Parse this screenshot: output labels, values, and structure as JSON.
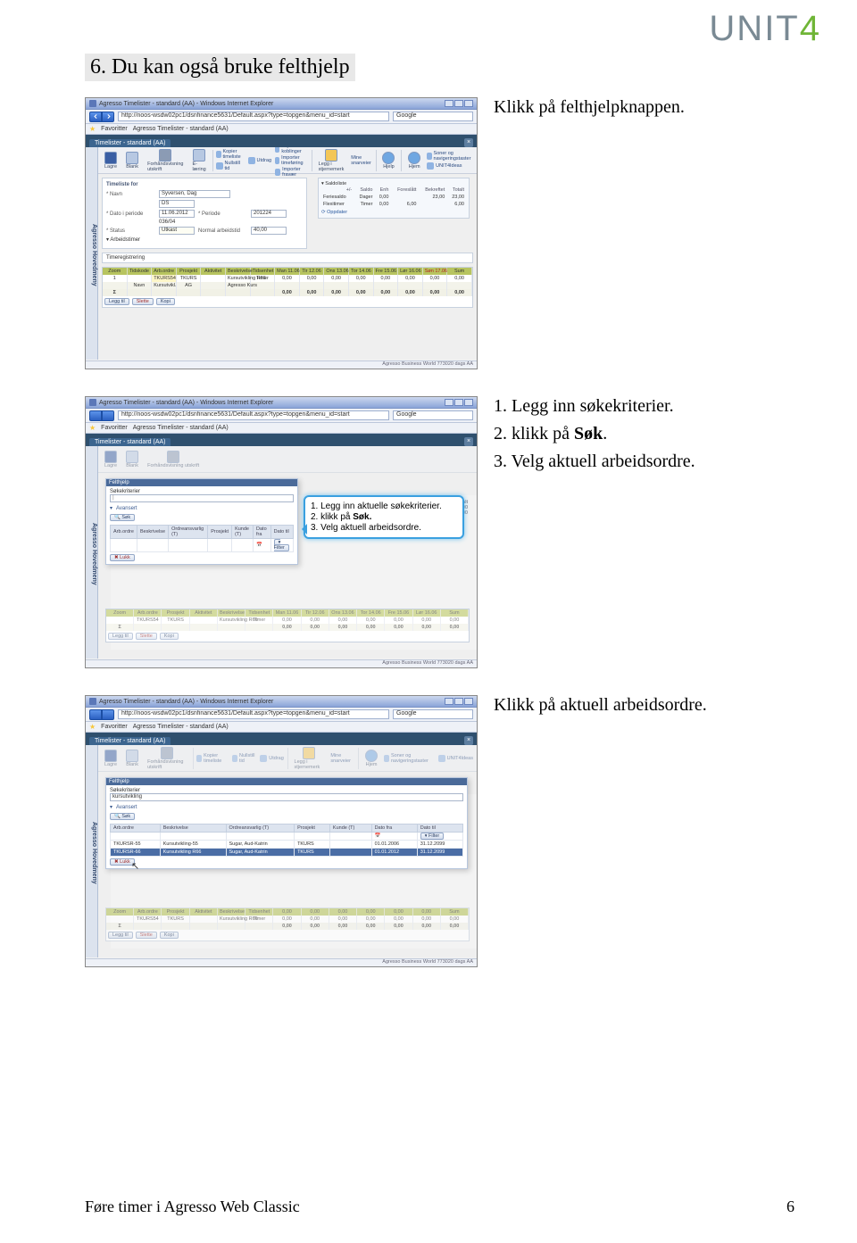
{
  "logo": {
    "text": "UNIT",
    "four": "4"
  },
  "heading": "6. Du kan også bruke felthjelp",
  "caption1": "Klikk på felthjelpknappen.",
  "steps": {
    "s1": "1. Legg inn søkekriterier.",
    "s2pre": "2. klikk på ",
    "s2b": "Søk",
    "s2post": ".",
    "s3": "3. Velg aktuell arbeidsordre."
  },
  "caption3": "Klikk på aktuell arbeidsordre.",
  "window": {
    "title": "Agresso Timelister - standard (AA) - Windows Internet Explorer",
    "url": "http://noos-wsdw02pc1/dsnfinance5631/Default.aspx?type=topgen&menu_id=start",
    "search": "Google",
    "favorites": "Favoritter",
    "favtab": "Agresso Timelister - standard (AA)"
  },
  "tab": "Timelister - standard (AA)",
  "sidebar": "Agresso Hovedmeny",
  "toolbar": {
    "save": "Lagre",
    "blank": "Blank",
    "print": "Forhåndsvisning utskrift",
    "elearn": "E-læring",
    "kopier": "Kopier timeliste",
    "nullstill": "Nullstill tid",
    "utdrag": "Utdrag",
    "impkob": "Importer koblinger",
    "imptime": "Importer timeføring",
    "impfra": "Importer fravær",
    "legg": "Legg i stjernemerk",
    "mine": "Mine snarveier",
    "hjelp": "Hjelp",
    "info": "Hjem",
    "soner": "Soner og navigeringstaster",
    "u4ideas": "UNIT4Ideas"
  },
  "panel": {
    "hd": "Timeliste for",
    "navn_l": "Navn",
    "navn_v": "Syversen, Dag",
    "navn_c": "DS",
    "dato_l": "Dato i periode",
    "dato_v": "11.06.2012",
    "per_l": "Periode",
    "per_v": "201224",
    "per_d": "036/04",
    "status_l": "Status",
    "status_v": "Utkast",
    "norm_l": "Normal arbeidstid",
    "norm_v": "40,00",
    "arb": "Arbeidstimer"
  },
  "saldo": {
    "hd": "Saldoliste",
    "cols": [
      "+/-",
      "Saldo",
      "Enh",
      "Foreslått",
      "Bekreftet",
      "Totalt"
    ],
    "r1": [
      "Feriesaldo",
      "Dager",
      "0,00",
      "",
      "23,00",
      "23,00"
    ],
    "r2": [
      "Flexitimer",
      "Timer",
      "0,00",
      "6,00",
      "",
      "6,00"
    ],
    "upd": "Oppdater"
  },
  "grid": {
    "hd_timereg": "Timeregistrering",
    "cols": [
      "Zoom",
      "Tidskode",
      "Arb.ordre",
      "Prosjekt",
      "Aktivitet",
      "Beskrivelse",
      "Tidsenhet",
      "Man 11.06",
      "Tir 12.06",
      "Ons 13.06",
      "Tor 14.06",
      "Fre 15.06",
      "Lør 16.06",
      "Søn 17.06",
      "Sum"
    ],
    "row1": [
      "1",
      "",
      "TKURS54",
      "TKURS",
      "",
      "Kursutvikling R66",
      "Timer",
      "0,00",
      "0,00",
      "0,00",
      "0,00",
      "0,00",
      "0,00",
      "0,00",
      "0,00"
    ],
    "rowname": [
      "",
      "Navn",
      "Kursutvikl.",
      "AG",
      "",
      "Agresso Kurs",
      "",
      "",
      "",
      "",
      "",
      "",
      "",
      "",
      ""
    ],
    "totals": [
      "Σ",
      "",
      "",
      "",
      "",
      "",
      "",
      "0,00",
      "0,00",
      "0,00",
      "0,00",
      "0,00",
      "0,00",
      "0,00",
      "0,00"
    ],
    "legg": "Legg til",
    "slett": "Slette",
    "kopi": "Kopi"
  },
  "status_text": "Agresso Business World  773020   dags  AA",
  "felt": {
    "hd": "Felthjelp",
    "sok_l": "Søkekriterier",
    "sok_v": "kursutvikling",
    "av": "Avansert",
    "sok_btn": "Søk",
    "cols": [
      "Arb.ordre",
      "Beskrivelse",
      "Ordreansvarlig (T)",
      "Prosjekt",
      "Kunde (T)",
      "Dato fra",
      "Dato til"
    ],
    "filter": "Filter",
    "lukk": "Lukk",
    "rows": [
      [
        "TKURSR-55",
        "Kursutvikling-55",
        "Sugar, Aud-Katrin",
        "TKURS",
        "",
        "01.01.2006",
        "31.12.2099"
      ],
      [
        "TKURSR-66",
        "Kursutvikling R66",
        "Sugar, Aud-Katrin",
        "TKURS",
        "",
        "01.01.2012",
        "31.12.2099"
      ]
    ]
  },
  "callout": {
    "l1": "1. Legg inn aktuelle søkekriterier.",
    "l2a": "2. klikk på ",
    "l2b": "Søk.",
    "l3": "3. Velg aktuell arbeidsordre."
  },
  "saldo2": {
    "t1": "Totalt",
    "v1": "23,00",
    "v2": "6,00"
  },
  "footer": {
    "left": "Føre timer i Agresso Web Classic",
    "right": "6"
  }
}
